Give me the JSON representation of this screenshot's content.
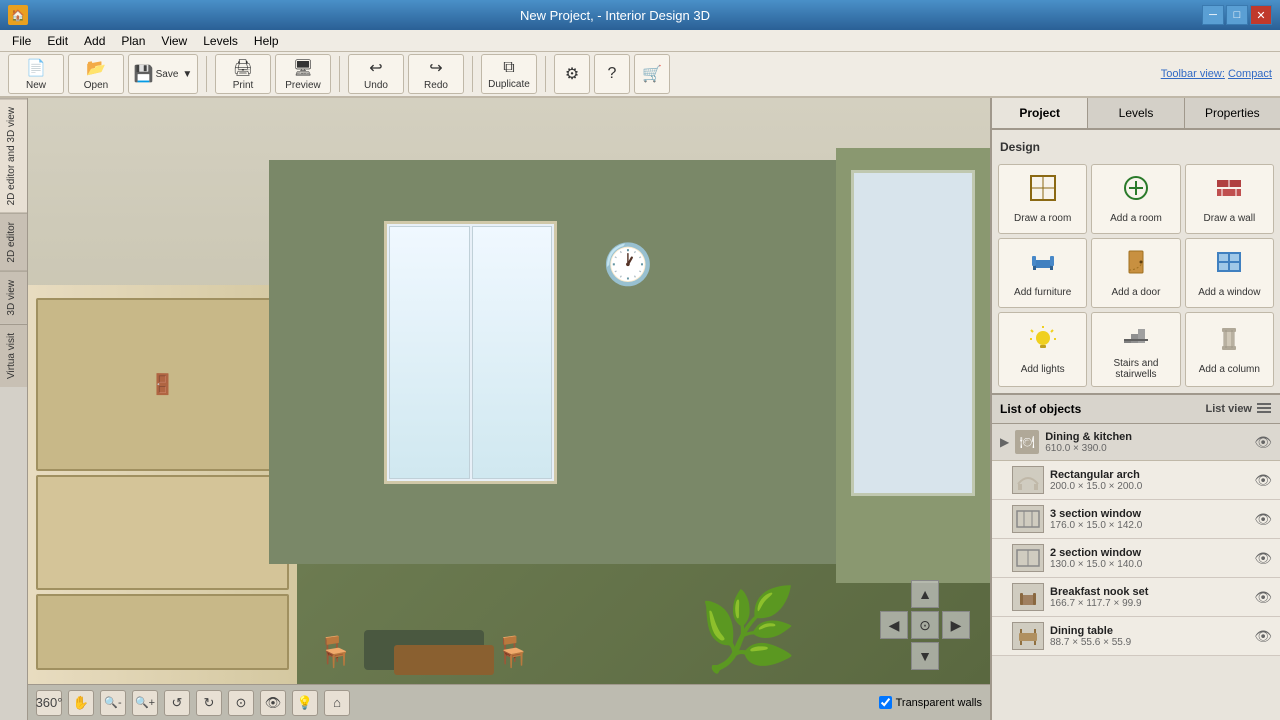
{
  "titlebar": {
    "title": "New Project, - Interior Design 3D",
    "app_icon": "🏠"
  },
  "toolbar_view": {
    "label": "Toolbar view:",
    "compact": "Compact"
  },
  "menubar": {
    "items": [
      {
        "id": "file",
        "label": "File"
      },
      {
        "id": "edit",
        "label": "Edit"
      },
      {
        "id": "add",
        "label": "Add"
      },
      {
        "id": "plan",
        "label": "Plan"
      },
      {
        "id": "view",
        "label": "View"
      },
      {
        "id": "levels",
        "label": "Levels"
      },
      {
        "id": "help",
        "label": "Help"
      }
    ]
  },
  "toolbar": {
    "buttons": [
      {
        "id": "new",
        "label": "New",
        "icon": "📄"
      },
      {
        "id": "open",
        "label": "Open",
        "icon": "📂"
      },
      {
        "id": "save",
        "label": "Save",
        "icon": "💾"
      },
      {
        "id": "print",
        "label": "Print",
        "icon": "🖨"
      },
      {
        "id": "preview",
        "label": "Preview",
        "icon": "🖥"
      },
      {
        "id": "undo",
        "label": "Undo",
        "icon": "↩"
      },
      {
        "id": "redo",
        "label": "Redo",
        "icon": "↪"
      },
      {
        "id": "duplicate",
        "label": "Duplicate",
        "icon": "⧉"
      },
      {
        "id": "settings",
        "label": "⚙",
        "icon": "⚙"
      },
      {
        "id": "help",
        "label": "?",
        "icon": "?"
      },
      {
        "id": "store",
        "label": "🛒",
        "icon": "🛒"
      }
    ]
  },
  "side_tabs": [
    {
      "id": "2d3d",
      "label": "2D editor and 3D view"
    },
    {
      "id": "2d",
      "label": "2D editor"
    },
    {
      "id": "3d",
      "label": "3D view"
    },
    {
      "id": "virtual",
      "label": "Virtua visit"
    }
  ],
  "panel_tabs": [
    {
      "id": "project",
      "label": "Project"
    },
    {
      "id": "levels",
      "label": "Levels"
    },
    {
      "id": "properties",
      "label": "Properties"
    }
  ],
  "design": {
    "title": "Design",
    "buttons": [
      {
        "id": "draw-room",
        "label": "Draw a room",
        "icon": "🏠"
      },
      {
        "id": "add-room",
        "label": "Add a room",
        "icon": "➕"
      },
      {
        "id": "draw-wall",
        "label": "Draw a wall",
        "icon": "🧱"
      },
      {
        "id": "add-furniture",
        "label": "Add furniture",
        "icon": "🪑"
      },
      {
        "id": "add-door",
        "label": "Add a door",
        "icon": "🚪"
      },
      {
        "id": "add-window",
        "label": "Add a window",
        "icon": "🪟"
      },
      {
        "id": "add-lights",
        "label": "Add lights",
        "icon": "💡"
      },
      {
        "id": "stairs",
        "label": "Stairs and stairwells",
        "icon": "🪜"
      },
      {
        "id": "add-column",
        "label": "Add a column",
        "icon": "🏛"
      }
    ]
  },
  "objects_list": {
    "title": "List of objects",
    "list_view_label": "List view",
    "items": [
      {
        "id": "dining-kitchen",
        "type": "category",
        "name": "Dining & kitchen",
        "dims": "610.0 × 390.0",
        "icon": "🍽"
      },
      {
        "id": "rectangular-arch",
        "type": "item",
        "name": "Rectangular arch",
        "dims": "200.0 × 15.0 × 200.0",
        "icon": "⬜"
      },
      {
        "id": "3-section-window",
        "type": "item",
        "name": "3 section window",
        "dims": "176.0 × 15.0 × 142.0",
        "icon": "⬜"
      },
      {
        "id": "2-section-window",
        "type": "item",
        "name": "2 section window",
        "dims": "130.0 × 15.0 × 140.0",
        "icon": "⬜"
      },
      {
        "id": "breakfast-nook",
        "type": "item",
        "name": "Breakfast nook set",
        "dims": "166.7 × 117.7 × 99.9",
        "icon": "🪑"
      },
      {
        "id": "dining-table",
        "type": "item",
        "name": "Dining table",
        "dims": "88.7 × 55.6 × 55.9",
        "icon": "🪑"
      }
    ]
  },
  "viewport": {
    "transparent_walls": {
      "label": "Transparent walls",
      "checked": true
    }
  },
  "bottom_tools": [
    {
      "id": "360",
      "icon": "360°",
      "label": "360 view"
    },
    {
      "id": "pan",
      "icon": "✋",
      "label": "Pan"
    },
    {
      "id": "zoom-out",
      "icon": "🔍−",
      "label": "Zoom out"
    },
    {
      "id": "zoom-in",
      "icon": "🔍+",
      "label": "Zoom in"
    },
    {
      "id": "orbit",
      "icon": "↺",
      "label": "Orbit"
    },
    {
      "id": "rotate",
      "icon": "↻",
      "label": "Rotate"
    },
    {
      "id": "section",
      "icon": "⊙",
      "label": "Section"
    },
    {
      "id": "walkthrough",
      "icon": "👁",
      "label": "Walkthrough"
    },
    {
      "id": "light",
      "icon": "💡",
      "label": "Light"
    },
    {
      "id": "home",
      "icon": "⌂",
      "label": "Home"
    }
  ]
}
